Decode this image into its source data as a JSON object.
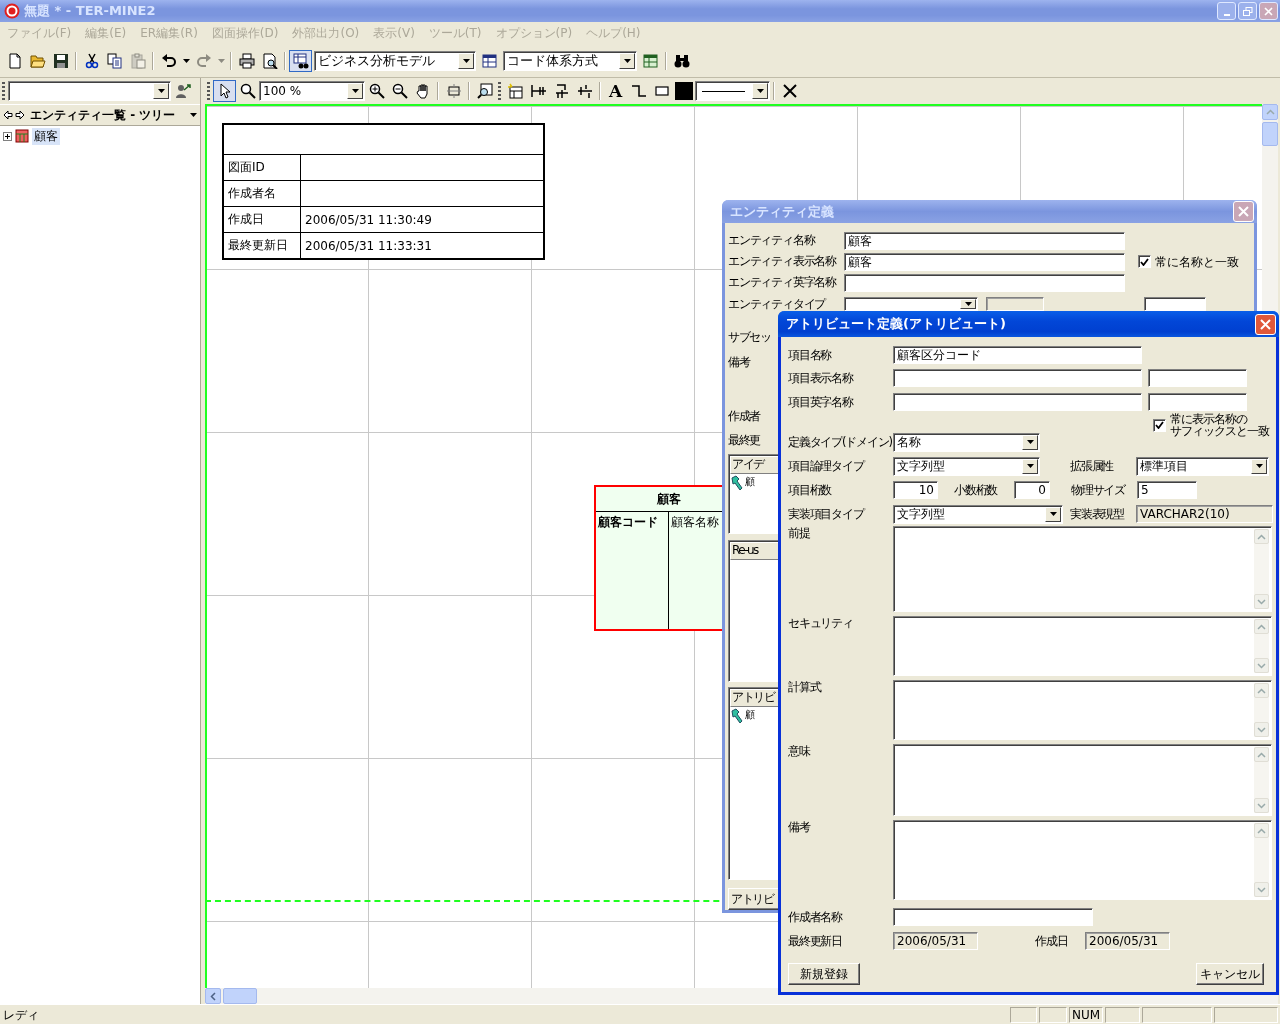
{
  "window": {
    "title": "無題 * - TER-MINE2"
  },
  "menu": [
    {
      "label": "ファイル(F)",
      "disabled": true
    },
    {
      "label": "編集(E)",
      "disabled": true
    },
    {
      "label": "ER編集(R)",
      "disabled": true
    },
    {
      "label": "図面操作(D)",
      "disabled": true
    },
    {
      "label": "外部出力(O)",
      "disabled": true
    },
    {
      "label": "表示(V)",
      "disabled": true
    },
    {
      "label": "ツール(T)",
      "disabled": true
    },
    {
      "label": "オプション(P)",
      "disabled": true
    },
    {
      "label": "ヘルプ(H)",
      "disabled": true
    }
  ],
  "toolbar": [
    {
      "kind": "button",
      "disabled": false,
      "pressed": false
    },
    {
      "kind": "button",
      "disabled": false,
      "pressed": false
    },
    {
      "kind": "button",
      "disabled": false,
      "pressed": false
    },
    {
      "kind": "separator"
    },
    {
      "kind": "button",
      "disabled": false,
      "pressed": false
    },
    {
      "kind": "button",
      "disabled": false,
      "pressed": false
    },
    {
      "kind": "button",
      "disabled": true,
      "pressed": false
    },
    {
      "kind": "separator"
    },
    {
      "kind": "button",
      "disabled": false,
      "pressed": false
    },
    {
      "kind": "caret",
      "disabled": false
    },
    {
      "kind": "button",
      "disabled": true,
      "pressed": false
    },
    {
      "kind": "caret",
      "disabled": true
    },
    {
      "kind": "separator"
    },
    {
      "kind": "button",
      "disabled": false,
      "pressed": false
    },
    {
      "kind": "button",
      "disabled": false,
      "pressed": false
    },
    {
      "kind": "separator"
    },
    {
      "kind": "button",
      "disabled": false,
      "pressed": true
    },
    {
      "kind": "combo",
      "value": "ビジネス分析モデル"
    },
    {
      "kind": "button",
      "disabled": false,
      "pressed": false
    },
    {
      "kind": "combo",
      "value": "コード体系方式"
    },
    {
      "kind": "button",
      "disabled": false,
      "pressed": false
    },
    {
      "kind": "separator"
    },
    {
      "kind": "button",
      "disabled": false,
      "pressed": false
    }
  ],
  "diagram_toolbar": [
    {
      "kind": "grip"
    },
    {
      "kind": "button",
      "pressed": true
    },
    {
      "kind": "button",
      "pressed": false
    },
    {
      "kind": "combo",
      "value": "100 %"
    },
    {
      "kind": "button",
      "pressed": false
    },
    {
      "kind": "button",
      "pressed": false
    },
    {
      "kind": "button",
      "pressed": false
    },
    {
      "kind": "separator"
    },
    {
      "kind": "button",
      "pressed": false
    },
    {
      "kind": "separator"
    },
    {
      "kind": "button",
      "pressed": false
    },
    {
      "kind": "grip"
    },
    {
      "kind": "button",
      "pressed": false
    },
    {
      "kind": "button",
      "pressed": false
    },
    {
      "kind": "button",
      "pressed": false
    },
    {
      "kind": "button",
      "pressed": false
    },
    {
      "kind": "separator"
    },
    {
      "kind": "text",
      "label": "A",
      "pressed": false
    },
    {
      "kind": "button",
      "pressed": false
    },
    {
      "kind": "button",
      "pressed": false
    },
    {
      "kind": "swatch",
      "color": "#000000"
    },
    {
      "kind": "line_combo"
    },
    {
      "kind": "separator"
    },
    {
      "kind": "button",
      "pressed": false
    }
  ],
  "sidebar": {
    "title": "エンティティ一覧 - ツリー",
    "tree": [
      {
        "label": "顧客",
        "expanded": false,
        "selected": true
      }
    ]
  },
  "diagram": {
    "title_block": [
      {
        "label": "図面ID"
      },
      {
        "label": "作成者名"
      },
      {
        "label": "作成日",
        "value": "2006/05/31 11:30:49"
      },
      {
        "label": "最終更新日",
        "value": "2006/05/31 11:33:31"
      }
    ],
    "entity": {
      "name": "顧客",
      "columns": [
        {
          "name": "顧客コード",
          "primary_key": true
        },
        {
          "name": "顧客名称",
          "primary_key": false
        }
      ]
    }
  },
  "entity_dialog": {
    "title": "エンティティ定義",
    "name": {
      "label": "エンティティ名称",
      "value": "顧客"
    },
    "display_name": {
      "label": "エンティティ表示名称",
      "value": "顧客"
    },
    "match_name": {
      "label": "常に名称と一致",
      "checked": true
    },
    "english_name": {
      "label": "エンティティ英字名称"
    },
    "type": {
      "label": "エンティティタイプ"
    },
    "labels": [
      "サブセッ",
      "備考",
      "作成者",
      "最終更"
    ],
    "lists": [
      {
        "header": "アイデ",
        "items": [
          "顧"
        ]
      },
      {
        "header": "Re-us"
      },
      {
        "header": "アトリビ",
        "items": [
          "顧"
        ]
      }
    ],
    "button": "アトリビ"
  },
  "attribute_dialog": {
    "title": "アトリビュート定義(アトリビュート)",
    "item_name": {
      "label": "項目名称",
      "value": "顧客区分コード"
    },
    "display_name": {
      "label": "項目表示名称"
    },
    "english_name": {
      "label": "項目英字名称"
    },
    "suffix_match": {
      "label_lines": [
        "常に表示名称の",
        "サフィックスと一致"
      ],
      "checked": true
    },
    "domain": {
      "label": "定義タイプ(ドメイン)",
      "value": "名称"
    },
    "logical_type": {
      "label": "項目論理タイプ",
      "value": "文字列型"
    },
    "extension": {
      "label": "拡張属性",
      "value": "標準項目"
    },
    "digits": {
      "label": "項目桁数",
      "value": "10"
    },
    "decimals": {
      "label": "小数桁数",
      "value": "0"
    },
    "physical_size": {
      "label": "物理サイズ",
      "value": "5"
    },
    "impl_type": {
      "label": "実装項目タイプ",
      "value": "文字列型"
    },
    "impl_repr": {
      "label": "実装表現型",
      "value": "VARCHAR2(10)",
      "disabled": true
    },
    "notes": [
      {
        "label": "前提"
      },
      {
        "label": "セキュリティ"
      },
      {
        "label": "計算式"
      },
      {
        "label": "意味"
      },
      {
        "label": "備考"
      }
    ],
    "author": {
      "label": "作成者名称"
    },
    "updated": {
      "label": "最終更新日",
      "value": "2006/05/31",
      "disabled": true
    },
    "created": {
      "label": "作成日",
      "value": "2006/05/31",
      "disabled": true
    },
    "buttons": [
      "新規登録",
      "キャンセル"
    ]
  },
  "status_bar": {
    "message": "レディ",
    "num_lock": "NUM"
  }
}
